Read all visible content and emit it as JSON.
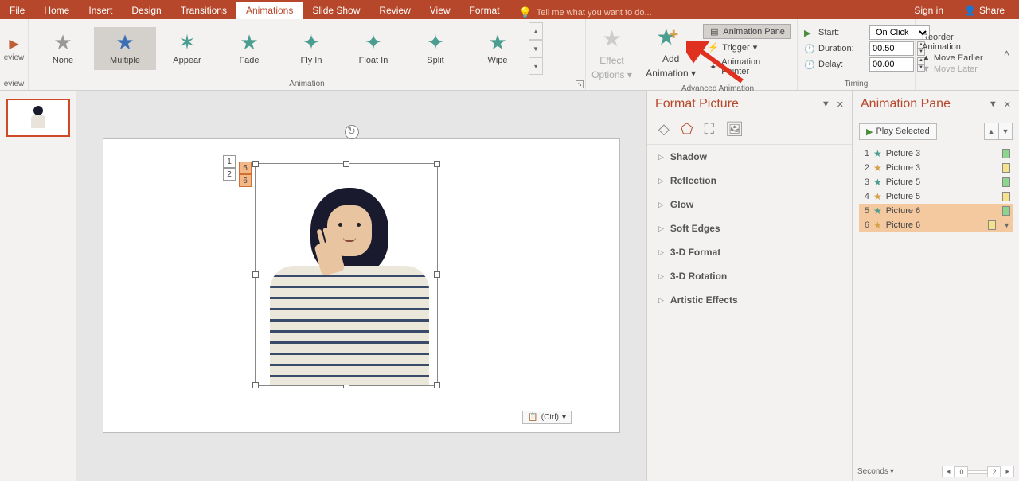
{
  "tabs": {
    "file": "File",
    "home": "Home",
    "insert": "Insert",
    "design": "Design",
    "transitions": "Transitions",
    "animations": "Animations",
    "slideshow": "Slide Show",
    "review": "Review",
    "view": "View",
    "format": "Format",
    "tellme": "Tell me what you want to do...",
    "signin": "Sign in",
    "share": "Share"
  },
  "ribbon": {
    "preview1": "eview",
    "preview2": "eview",
    "gallery": {
      "none": "None",
      "multiple": "Multiple",
      "appear": "Appear",
      "fade": "Fade",
      "flyin": "Fly In",
      "floatin": "Float In",
      "split": "Split",
      "wipe": "Wipe"
    },
    "animation_label": "Animation",
    "effect_options1": "Effect",
    "effect_options2": "Options",
    "add_anim1": "Add",
    "add_anim2": "Animation",
    "adv_label": "Advanced Animation",
    "anim_pane": "Animation Pane",
    "trigger": "Trigger",
    "anim_painter": "Animation Painter",
    "start_label": "Start:",
    "start_value": "On Click",
    "duration_label": "Duration:",
    "duration_value": "00.50",
    "delay_label": "Delay:",
    "delay_value": "00.00",
    "timing_label": "Timing",
    "reorder_title": "Reorder Animation",
    "move_earlier": "Move Earlier",
    "move_later": "Move Later"
  },
  "canvas": {
    "tag1": "1",
    "tag2": "2",
    "tag5": "5",
    "tag6": "6",
    "paste": "(Ctrl)"
  },
  "format_picture": {
    "title": "Format Picture",
    "shadow": "Shadow",
    "reflection": "Reflection",
    "glow": "Glow",
    "soft_edges": "Soft Edges",
    "format3d": "3-D Format",
    "rotation3d": "3-D Rotation",
    "artistic": "Artistic Effects"
  },
  "anim_pane": {
    "title": "Animation Pane",
    "play": "Play Selected",
    "items": [
      {
        "num": "1",
        "name": "Picture 3",
        "color": "green",
        "star": "green"
      },
      {
        "num": "2",
        "name": "Picture 3",
        "color": "yellow",
        "star": "orange"
      },
      {
        "num": "3",
        "name": "Picture 5",
        "color": "green",
        "star": "green"
      },
      {
        "num": "4",
        "name": "Picture 5",
        "color": "yellow",
        "star": "orange"
      },
      {
        "num": "5",
        "name": "Picture 6",
        "color": "green",
        "star": "green"
      },
      {
        "num": "6",
        "name": "Picture 6",
        "color": "yellow",
        "star": "orange"
      }
    ],
    "seconds": "Seconds",
    "tl_0": "0",
    "tl_2": "2"
  }
}
